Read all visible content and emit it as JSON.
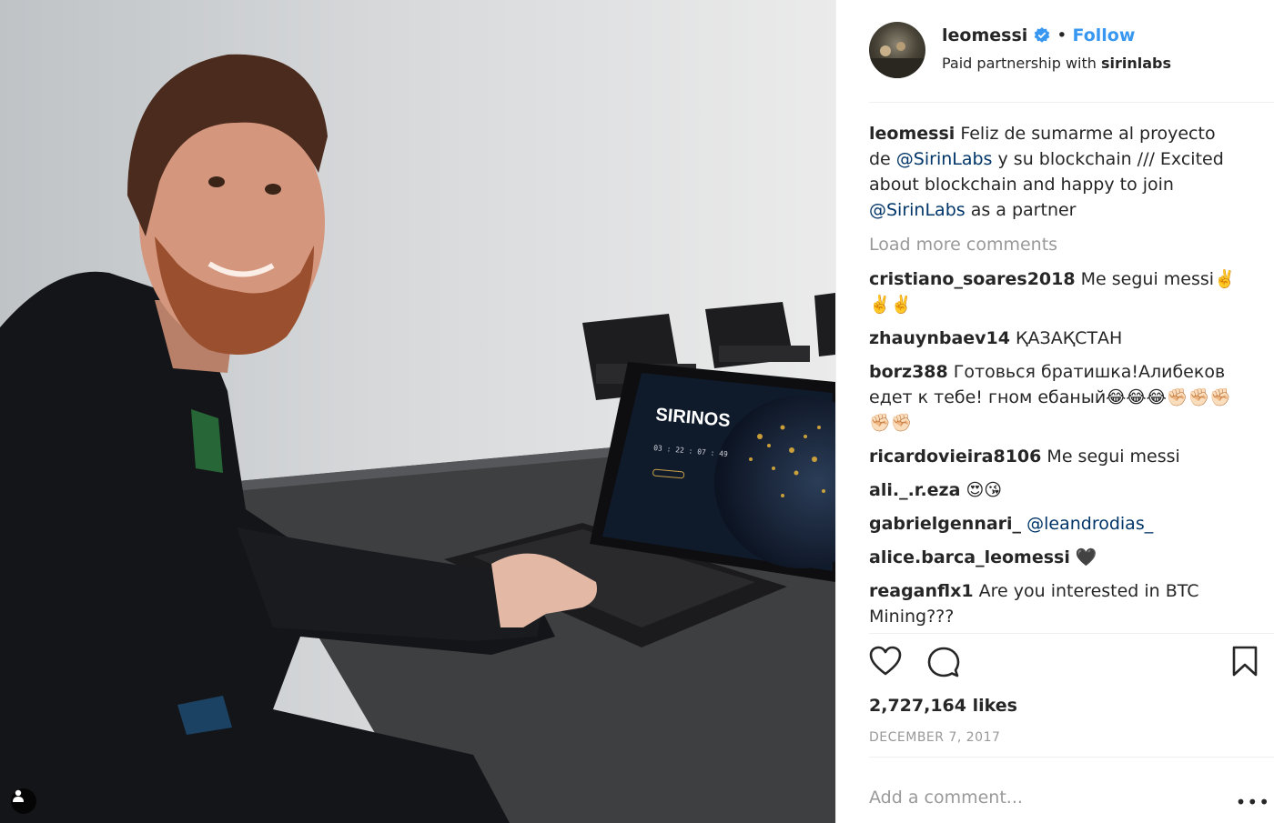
{
  "post": {
    "photo": {
      "screen_brand": "SIRINOS",
      "screen_brand_sup": "™",
      "screen_countdown": "03 : 22 : 07 : 49"
    },
    "author": {
      "username": "leomessi",
      "separator": "•",
      "follow_label": "Follow",
      "partnership_prefix": "Paid partnership with",
      "partner": "sirinlabs"
    },
    "caption": {
      "user": "leomessi",
      "t1": "Feliz de sumarme al proyecto de",
      "m1": "@SirinLabs",
      "t2": "y su blockchain /// Excited about blockchain and happy to join",
      "m2": "@SirinLabs",
      "t3": "as a partner"
    },
    "load_more": "Load more comments",
    "comments": [
      {
        "user": "cristiano_soares2018",
        "text": "Me segui messi✌️✌️✌️"
      },
      {
        "user": "zhauynbaev14",
        "text": "ҚАЗАҚСТАН"
      },
      {
        "user": "borz388",
        "text": "Готовься братишка!Алибеков едет к тебе! гном ебаный😂😂😂✊🏻✊🏻✊🏻✊🏻✊🏻"
      },
      {
        "user": "ricardovieira8106",
        "text": "Me segui messi"
      },
      {
        "user": "ali._.r.eza",
        "text": "😍😘"
      },
      {
        "user": "gabrielgennari_",
        "text": "",
        "mention": "@leandrodias_"
      },
      {
        "user": "alice.barca_leomessi",
        "text": "🖤"
      },
      {
        "user": "reaganflx1",
        "text": "Are you interested in BTC Mining???"
      }
    ],
    "likes": "2,727,164 likes",
    "date": "DECEMBER 7, 2017",
    "add_comment_placeholder": "Add a comment...",
    "more_options": "•••",
    "colors": {
      "accent": "#3897f0",
      "mention": "#003569",
      "muted": "#999999",
      "text": "#262626"
    },
    "icons": {
      "like": "heart-icon",
      "comment": "comment-bubble-icon",
      "save": "bookmark-icon",
      "verified": "verified-badge-icon",
      "tag": "user-tag-icon"
    }
  }
}
